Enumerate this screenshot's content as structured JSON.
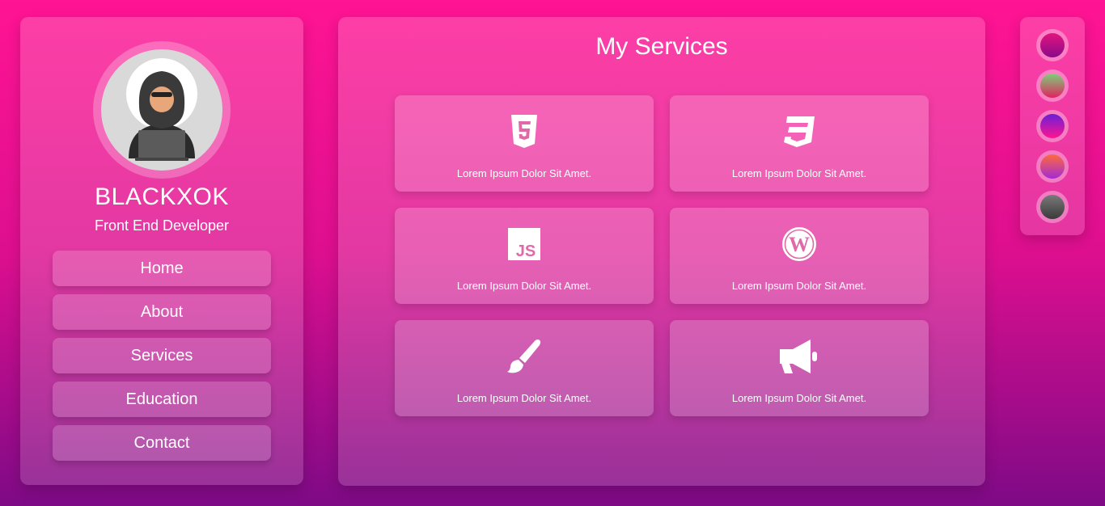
{
  "profile": {
    "name": "BLACKXOK",
    "role": "Front End Developer"
  },
  "nav": [
    {
      "label": "Home"
    },
    {
      "label": "About"
    },
    {
      "label": "Services"
    },
    {
      "label": "Education"
    },
    {
      "label": "Contact"
    }
  ],
  "services": {
    "title": "My Services",
    "cards": [
      {
        "icon": "html5-icon",
        "text": "Lorem Ipsum Dolor Sit Amet."
      },
      {
        "icon": "css3-icon",
        "text": "Lorem Ipsum Dolor Sit Amet."
      },
      {
        "icon": "javascript-icon",
        "text": "Lorem Ipsum Dolor Sit Amet."
      },
      {
        "icon": "wordpress-icon",
        "text": "Lorem Ipsum Dolor Sit Amet."
      },
      {
        "icon": "paint-brush-icon",
        "text": "Lorem Ipsum Dolor Sit Amet."
      },
      {
        "icon": "megaphone-icon",
        "text": "Lorem Ipsum Dolor Sit Amet."
      }
    ]
  },
  "themes": [
    {
      "name": "magenta",
      "colors": [
        "#e3147e",
        "#8a0a8a"
      ]
    },
    {
      "name": "green-red",
      "colors": [
        "#7dd07a",
        "#e0245e"
      ]
    },
    {
      "name": "pink-purple",
      "colors": [
        "#ff1493",
        "#6a1fd6"
      ]
    },
    {
      "name": "orange-violet",
      "colors": [
        "#ff6a3d",
        "#a32ad6"
      ]
    },
    {
      "name": "gray",
      "colors": [
        "#7a7a7a",
        "#3a3a3a"
      ]
    }
  ],
  "colors": {
    "bg_top": "#ff1493",
    "bg_bottom": "#7e0a86",
    "icon_fill": "#ffffff",
    "icon_accent": "#e06aa8"
  }
}
